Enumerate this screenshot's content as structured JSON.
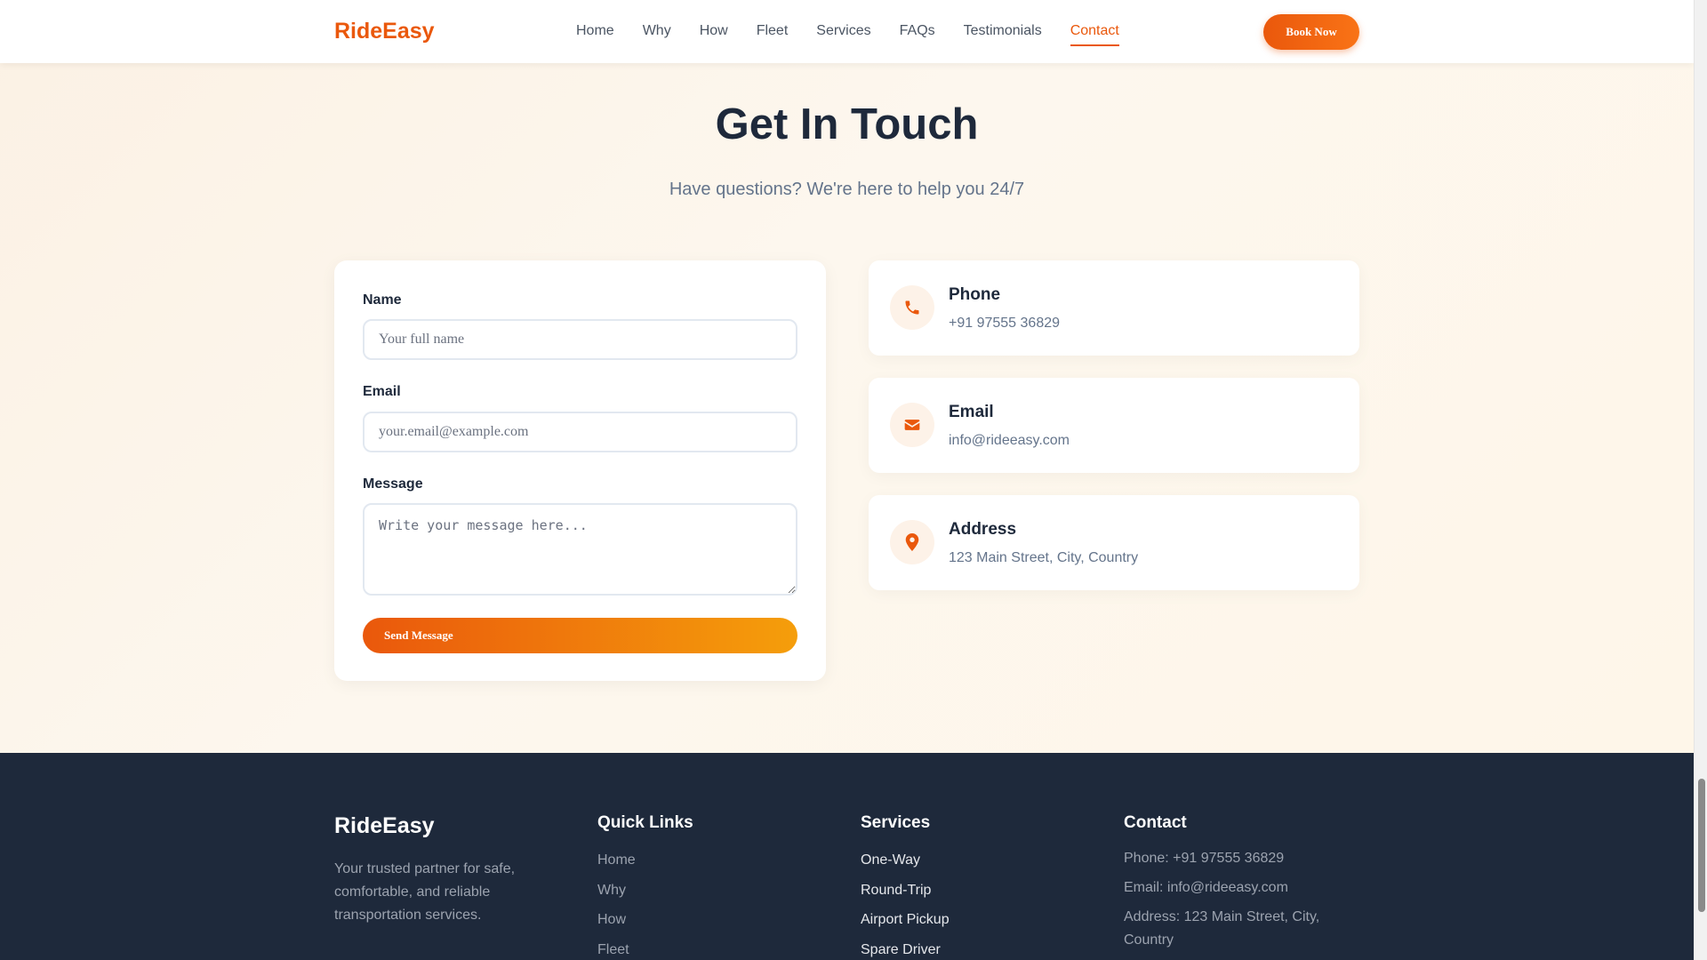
{
  "header": {
    "logo": "RideEasy",
    "nav": [
      "Home",
      "Why",
      "How",
      "Fleet",
      "Services",
      "FAQs",
      "Testimonials",
      "Contact"
    ],
    "active_nav": "Contact",
    "book_button": "Book Now"
  },
  "hero": {
    "title": "Get In Touch",
    "subtitle": "Have questions? We're here to help you 24/7"
  },
  "form": {
    "name_label": "Name",
    "name_placeholder": "Your full name",
    "email_label": "Email",
    "email_placeholder": "your.email@example.com",
    "message_label": "Message",
    "message_placeholder": "Write your message here...",
    "send_button": "Send Message"
  },
  "contact_cards": [
    {
      "title": "Phone",
      "value": "+91 97555 36829",
      "icon": "phone-icon"
    },
    {
      "title": "Email",
      "value": "info@rideeasy.com",
      "icon": "envelope-icon"
    },
    {
      "title": "Address",
      "value": "123 Main Street, City, Country",
      "icon": "map-pin-icon"
    }
  ],
  "footer": {
    "brand": "RideEasy",
    "description": "Your trusted partner for safe, comfortable, and reliable transportation services.",
    "quick_links_title": "Quick Links",
    "quick_links": [
      "Home",
      "Why",
      "How",
      "Fleet"
    ],
    "services_title": "Services",
    "services": [
      "One-Way",
      "Round-Trip",
      "Airport Pickup",
      "Spare Driver"
    ],
    "contact_title": "Contact",
    "contact": [
      "Phone: +91 97555 36829",
      "Email: info@rideeasy.com",
      "Address: 123 Main Street, City, Country"
    ]
  },
  "colors": {
    "accent": "#ea580c",
    "accent_light": "#f59e0b",
    "heading": "#1e293b",
    "footer_bg": "#1e293b"
  }
}
